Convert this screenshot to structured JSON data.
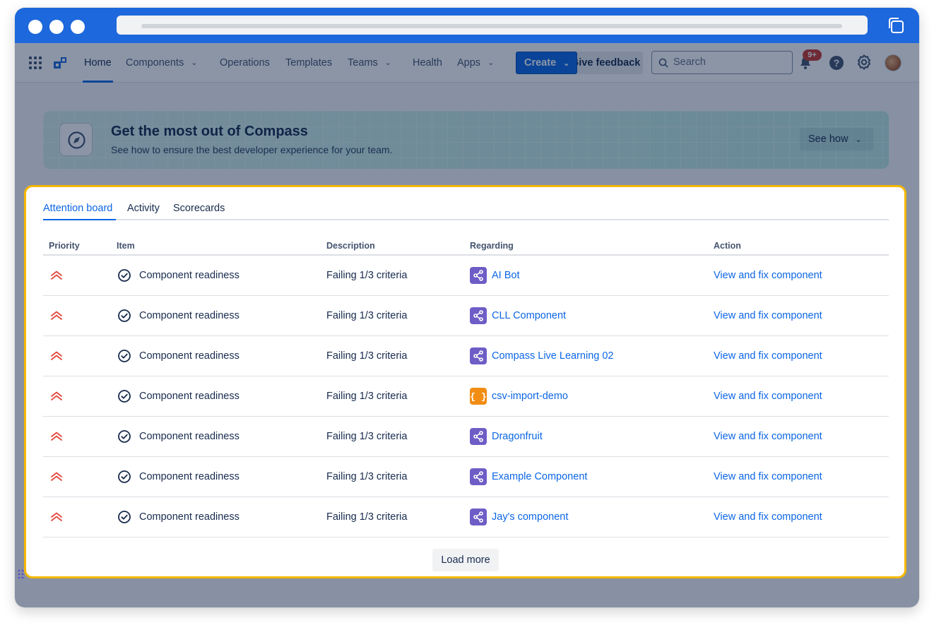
{
  "colors": {
    "chrome_blue": "#1d68dc",
    "primary_blue": "#0c66e4",
    "panel_highlight": "#f5b800",
    "priority_red": "#e2483d",
    "component_purple": "#6e5dc6",
    "component_orange": "#f18d13",
    "badge_red": "#c9372c"
  },
  "nav": {
    "apps_icon": "app-switcher-grid-icon",
    "logo_icon": "compass-logo-icon",
    "items": [
      {
        "label": "Home",
        "dropdown": false,
        "active": true
      },
      {
        "label": "Components",
        "dropdown": true
      },
      {
        "label": "Operations",
        "dropdown": false
      },
      {
        "label": "Templates",
        "dropdown": false
      },
      {
        "label": "Teams",
        "dropdown": true
      },
      {
        "label": "Health",
        "dropdown": false
      },
      {
        "label": "Apps",
        "dropdown": true
      }
    ],
    "create_label": "Create",
    "feedback_label": "Give feedback",
    "search_placeholder": "Search",
    "notifications_badge": "9+",
    "icons": [
      "notification-bell-icon",
      "help-icon",
      "settings-gear-icon"
    ]
  },
  "banner": {
    "title": "Get the most out of Compass",
    "subtitle": "See how to ensure the best developer experience for your team.",
    "button_label": "See how",
    "icon": "compass-icon"
  },
  "panel": {
    "tabs": [
      {
        "label": "Attention board",
        "active": true
      },
      {
        "label": "Activity",
        "active": false
      },
      {
        "label": "Scorecards",
        "active": false
      }
    ],
    "columns": [
      "Priority",
      "Item",
      "Description",
      "Regarding",
      "Action"
    ],
    "rows": [
      {
        "priority": "highest",
        "item": "Component readiness",
        "description": "Failing 1/3 criteria",
        "regarding": "AI Bot",
        "type": "service",
        "action": "View and fix component"
      },
      {
        "priority": "highest",
        "item": "Component readiness",
        "description": "Failing 1/3 criteria",
        "regarding": "CLL Component",
        "type": "service",
        "action": "View and fix component"
      },
      {
        "priority": "highest",
        "item": "Component readiness",
        "description": "Failing 1/3 criteria",
        "regarding": "Compass Live Learning 02",
        "type": "service",
        "action": "View and fix component"
      },
      {
        "priority": "highest",
        "item": "Component readiness",
        "description": "Failing 1/3 criteria",
        "regarding": "csv-import-demo",
        "type": "library",
        "action": "View and fix component"
      },
      {
        "priority": "highest",
        "item": "Component readiness",
        "description": "Failing 1/3 criteria",
        "regarding": "Dragonfruit",
        "type": "service",
        "action": "View and fix component"
      },
      {
        "priority": "highest",
        "item": "Component readiness",
        "description": "Failing 1/3 criteria",
        "regarding": "Example Component",
        "type": "service",
        "action": "View and fix component"
      },
      {
        "priority": "highest",
        "item": "Component readiness",
        "description": "Failing 1/3 criteria",
        "regarding": "Jay's component",
        "type": "service",
        "action": "View and fix component"
      }
    ],
    "load_more_label": "Load more"
  }
}
